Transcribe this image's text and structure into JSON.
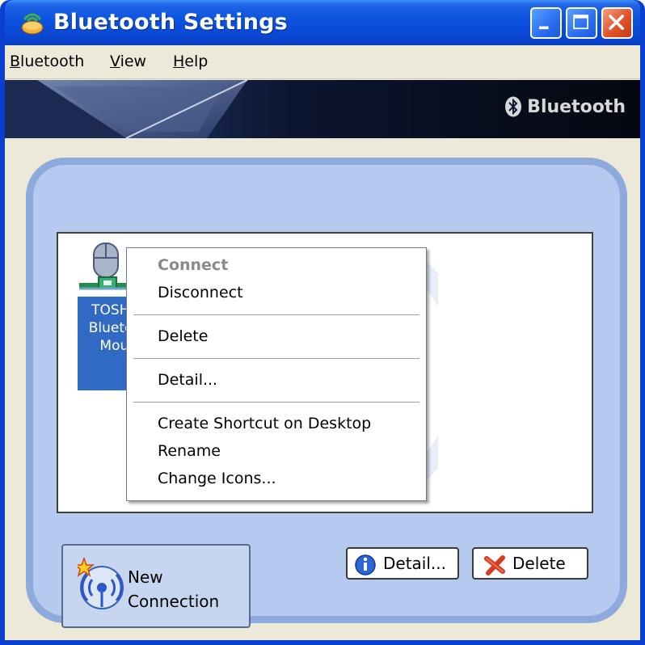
{
  "window": {
    "title": "Bluetooth Settings",
    "accent": "#0a52de"
  },
  "menubar": {
    "items": [
      {
        "label": "Bluetooth",
        "underline": "B"
      },
      {
        "label": "View",
        "underline": "V"
      },
      {
        "label": "Help",
        "underline": "H"
      }
    ]
  },
  "banner": {
    "logo_text": "Bluetooth"
  },
  "device": {
    "label": "TOSHIBA\nBluetooth\nMouse",
    "icon": "mouse-icon"
  },
  "context_menu": {
    "items": [
      {
        "label": "Connect",
        "disabled": true
      },
      {
        "label": "Disconnect"
      },
      {
        "label": "Delete"
      },
      {
        "label": "Detail..."
      },
      {
        "label": "Create Shortcut on Desktop"
      },
      {
        "label": "Rename"
      },
      {
        "label": "Change Icons..."
      }
    ]
  },
  "buttons": {
    "new_connection": "New\nConnection",
    "detail": "Detail...",
    "delete": "Delete"
  },
  "colors": {
    "selection": "#316ac5",
    "panel": "#b6c9ee",
    "panel_border": "#8ea9dc"
  }
}
